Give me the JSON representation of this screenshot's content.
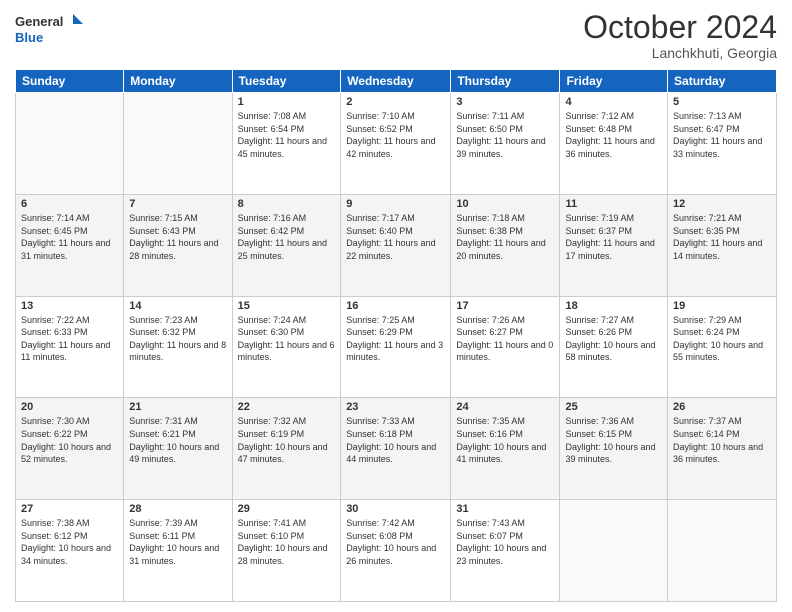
{
  "header": {
    "logo_line1": "General",
    "logo_line2": "Blue",
    "month": "October 2024",
    "location": "Lanchkhuti, Georgia"
  },
  "weekdays": [
    "Sunday",
    "Monday",
    "Tuesday",
    "Wednesday",
    "Thursday",
    "Friday",
    "Saturday"
  ],
  "weeks": [
    [
      {
        "day": "",
        "info": ""
      },
      {
        "day": "",
        "info": ""
      },
      {
        "day": "1",
        "info": "Sunrise: 7:08 AM\nSunset: 6:54 PM\nDaylight: 11 hours and 45 minutes."
      },
      {
        "day": "2",
        "info": "Sunrise: 7:10 AM\nSunset: 6:52 PM\nDaylight: 11 hours and 42 minutes."
      },
      {
        "day": "3",
        "info": "Sunrise: 7:11 AM\nSunset: 6:50 PM\nDaylight: 11 hours and 39 minutes."
      },
      {
        "day": "4",
        "info": "Sunrise: 7:12 AM\nSunset: 6:48 PM\nDaylight: 11 hours and 36 minutes."
      },
      {
        "day": "5",
        "info": "Sunrise: 7:13 AM\nSunset: 6:47 PM\nDaylight: 11 hours and 33 minutes."
      }
    ],
    [
      {
        "day": "6",
        "info": "Sunrise: 7:14 AM\nSunset: 6:45 PM\nDaylight: 11 hours and 31 minutes."
      },
      {
        "day": "7",
        "info": "Sunrise: 7:15 AM\nSunset: 6:43 PM\nDaylight: 11 hours and 28 minutes."
      },
      {
        "day": "8",
        "info": "Sunrise: 7:16 AM\nSunset: 6:42 PM\nDaylight: 11 hours and 25 minutes."
      },
      {
        "day": "9",
        "info": "Sunrise: 7:17 AM\nSunset: 6:40 PM\nDaylight: 11 hours and 22 minutes."
      },
      {
        "day": "10",
        "info": "Sunrise: 7:18 AM\nSunset: 6:38 PM\nDaylight: 11 hours and 20 minutes."
      },
      {
        "day": "11",
        "info": "Sunrise: 7:19 AM\nSunset: 6:37 PM\nDaylight: 11 hours and 17 minutes."
      },
      {
        "day": "12",
        "info": "Sunrise: 7:21 AM\nSunset: 6:35 PM\nDaylight: 11 hours and 14 minutes."
      }
    ],
    [
      {
        "day": "13",
        "info": "Sunrise: 7:22 AM\nSunset: 6:33 PM\nDaylight: 11 hours and 11 minutes."
      },
      {
        "day": "14",
        "info": "Sunrise: 7:23 AM\nSunset: 6:32 PM\nDaylight: 11 hours and 8 minutes."
      },
      {
        "day": "15",
        "info": "Sunrise: 7:24 AM\nSunset: 6:30 PM\nDaylight: 11 hours and 6 minutes."
      },
      {
        "day": "16",
        "info": "Sunrise: 7:25 AM\nSunset: 6:29 PM\nDaylight: 11 hours and 3 minutes."
      },
      {
        "day": "17",
        "info": "Sunrise: 7:26 AM\nSunset: 6:27 PM\nDaylight: 11 hours and 0 minutes."
      },
      {
        "day": "18",
        "info": "Sunrise: 7:27 AM\nSunset: 6:26 PM\nDaylight: 10 hours and 58 minutes."
      },
      {
        "day": "19",
        "info": "Sunrise: 7:29 AM\nSunset: 6:24 PM\nDaylight: 10 hours and 55 minutes."
      }
    ],
    [
      {
        "day": "20",
        "info": "Sunrise: 7:30 AM\nSunset: 6:22 PM\nDaylight: 10 hours and 52 minutes."
      },
      {
        "day": "21",
        "info": "Sunrise: 7:31 AM\nSunset: 6:21 PM\nDaylight: 10 hours and 49 minutes."
      },
      {
        "day": "22",
        "info": "Sunrise: 7:32 AM\nSunset: 6:19 PM\nDaylight: 10 hours and 47 minutes."
      },
      {
        "day": "23",
        "info": "Sunrise: 7:33 AM\nSunset: 6:18 PM\nDaylight: 10 hours and 44 minutes."
      },
      {
        "day": "24",
        "info": "Sunrise: 7:35 AM\nSunset: 6:16 PM\nDaylight: 10 hours and 41 minutes."
      },
      {
        "day": "25",
        "info": "Sunrise: 7:36 AM\nSunset: 6:15 PM\nDaylight: 10 hours and 39 minutes."
      },
      {
        "day": "26",
        "info": "Sunrise: 7:37 AM\nSunset: 6:14 PM\nDaylight: 10 hours and 36 minutes."
      }
    ],
    [
      {
        "day": "27",
        "info": "Sunrise: 7:38 AM\nSunset: 6:12 PM\nDaylight: 10 hours and 34 minutes."
      },
      {
        "day": "28",
        "info": "Sunrise: 7:39 AM\nSunset: 6:11 PM\nDaylight: 10 hours and 31 minutes."
      },
      {
        "day": "29",
        "info": "Sunrise: 7:41 AM\nSunset: 6:10 PM\nDaylight: 10 hours and 28 minutes."
      },
      {
        "day": "30",
        "info": "Sunrise: 7:42 AM\nSunset: 6:08 PM\nDaylight: 10 hours and 26 minutes."
      },
      {
        "day": "31",
        "info": "Sunrise: 7:43 AM\nSunset: 6:07 PM\nDaylight: 10 hours and 23 minutes."
      },
      {
        "day": "",
        "info": ""
      },
      {
        "day": "",
        "info": ""
      }
    ]
  ]
}
